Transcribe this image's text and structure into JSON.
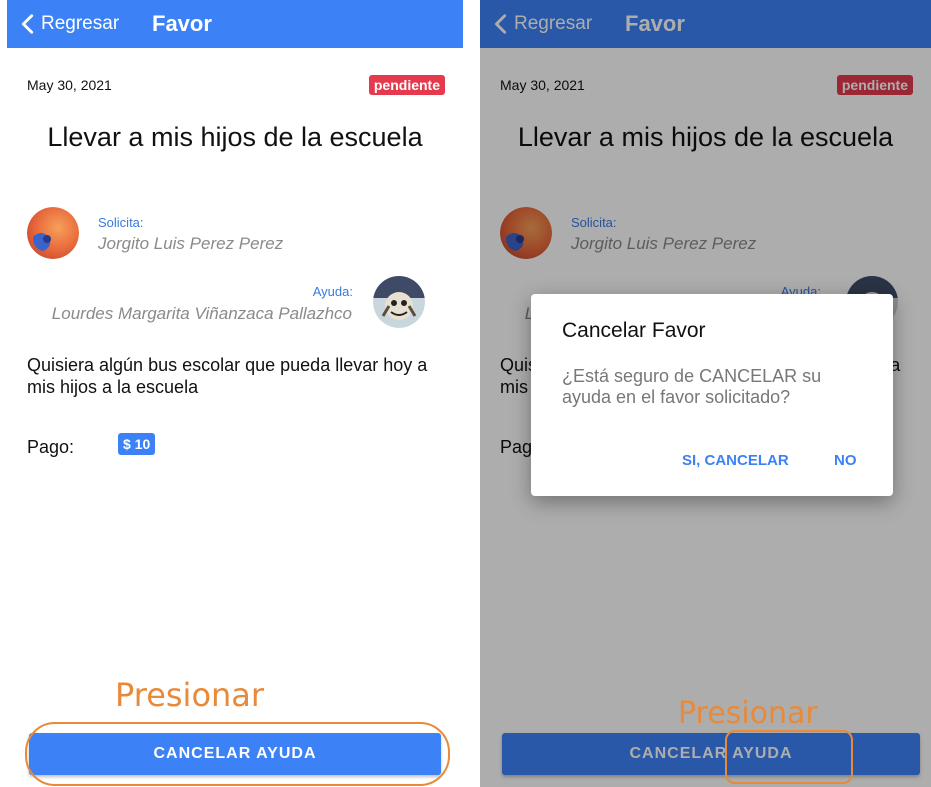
{
  "screen": {
    "back_label": "Regresar",
    "title": "Favor",
    "date": "May 30, 2021",
    "status_badge": "pendiente",
    "favor_title": "Llevar a mis hijos de la escuela",
    "solicita_label": "Solicita:",
    "solicita_name": "Jorgito Luis Perez Perez",
    "ayuda_label": "Ayuda:",
    "ayuda_name": "Lourdes Margarita Viñanzaca Pallazhco",
    "description": "Quisiera algún bus escolar que pueda llevar hoy a mis hijos a la escuela",
    "pago_label": "Pago:",
    "price": "$ 10",
    "cancel_button": "CANCELAR AYUDA"
  },
  "dialog": {
    "title": "Cancelar Favor",
    "message": "¿Está seguro de CANCELAR su ayuda en el favor solicitado?",
    "confirm_button": "SI, CANCELAR",
    "deny_button": "NO"
  },
  "annotations": {
    "press_hint": "Presionar"
  },
  "colors": {
    "primary": "#3c82f6",
    "badge_red": "#e53a4e",
    "annotation_orange": "#e88a3a"
  },
  "icons": {
    "back": "chevron-left-icon",
    "solicita_avatar": "avatar-orange-abstract",
    "ayuda_avatar": "avatar-illustration"
  }
}
